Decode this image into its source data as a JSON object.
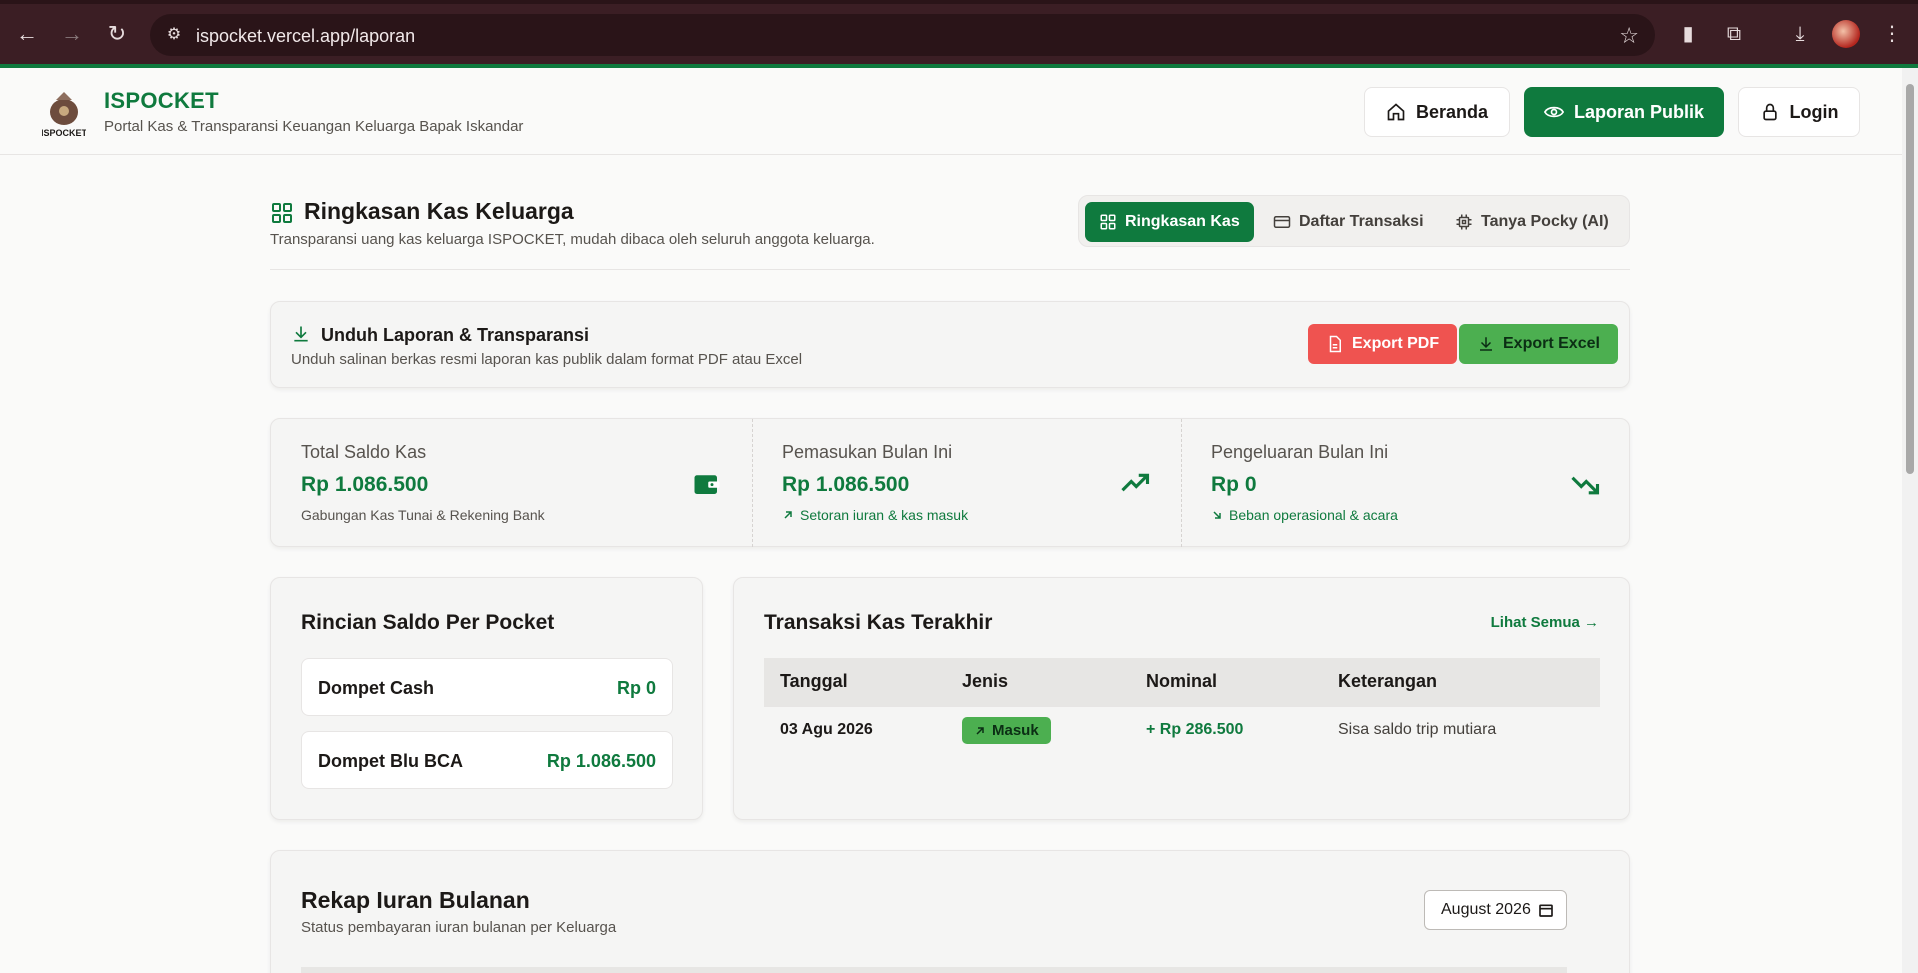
{
  "browser": {
    "url": "ispocket.vercel.app/laporan"
  },
  "brand": {
    "name": "ISPOCKET",
    "tagline": "Portal Kas & Transparansi Keuangan Keluarga Bapak Iskandar",
    "logo_text": "ISPOCKET"
  },
  "nav": {
    "home": "Beranda",
    "public_report": "Laporan Publik",
    "login": "Login"
  },
  "section": {
    "title": "Ringkasan Kas Keluarga",
    "subtitle": "Transparansi uang kas keluarga ISPOCKET, mudah dibaca oleh seluruh anggota keluarga.",
    "tabs": [
      "Ringkasan Kas",
      "Daftar Transaksi",
      "Tanya Pocky (AI)"
    ]
  },
  "download": {
    "title": "Unduh Laporan & Transparansi",
    "subtitle": "Unduh salinan berkas resmi laporan kas publik dalam format PDF atau Excel",
    "pdf": "Export PDF",
    "excel": "Export Excel"
  },
  "stats": [
    {
      "label": "Total Saldo Kas",
      "value": "Rp 1.086.500",
      "note": "Gabungan Kas Tunai & Rekening Bank"
    },
    {
      "label": "Pemasukan Bulan Ini",
      "value": "Rp 1.086.500",
      "note": "Setoran iuran & kas masuk"
    },
    {
      "label": "Pengeluaran Bulan Ini",
      "value": "Rp 0",
      "note": "Beban operasional & acara"
    }
  ],
  "pockets": {
    "title": "Rincian Saldo Per Pocket",
    "items": [
      {
        "name": "Dompet Cash",
        "value": "Rp 0"
      },
      {
        "name": "Dompet Blu BCA",
        "value": "Rp 1.086.500"
      }
    ]
  },
  "transactions": {
    "title": "Transaksi Kas Terakhir",
    "see_all": "Lihat Semua →",
    "columns": [
      "Tanggal",
      "Jenis",
      "Nominal",
      "Keterangan"
    ],
    "rows": [
      {
        "date": "03 Agu 2026",
        "type": "Masuk",
        "amount": "+ Rp 286.500",
        "note": "Sisa saldo trip mutiara"
      }
    ]
  },
  "recap": {
    "title": "Rekap Iuran Bulanan",
    "subtitle": "Status pembayaran iuran bulanan per Keluarga",
    "month": "August  2026"
  },
  "colors": {
    "brand": "#0f7a3e",
    "pdf": "#ef5350",
    "excel": "#4caf50",
    "chrome": "#3b1e24"
  }
}
